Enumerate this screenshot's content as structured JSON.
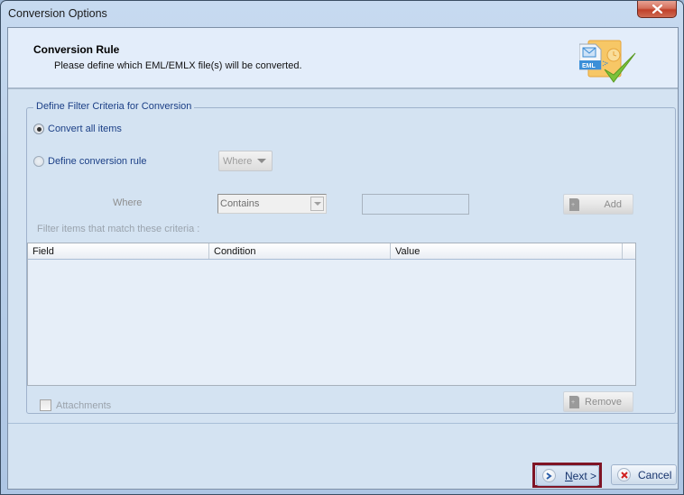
{
  "window": {
    "title": "Conversion Options",
    "close_icon": "close-x-icon"
  },
  "header": {
    "title": "Conversion Rule",
    "subtitle": "Please define which EML/EMLX file(s) will be converted.",
    "icon": "eml-convert-check-icon",
    "icon_label": "EML"
  },
  "filter_group": {
    "legend": "Define Filter Criteria for Conversion",
    "options": [
      {
        "label": "Convert all items",
        "checked": true
      },
      {
        "label": "Define conversion rule",
        "checked": false
      }
    ],
    "where_dropdown": {
      "value": "Where",
      "enabled": false
    },
    "where_label": "Where",
    "condition_combo": {
      "value": "Contains",
      "enabled": false
    },
    "value_input": {
      "value": "",
      "enabled": false
    },
    "add_button": {
      "label": "Add",
      "enabled": false
    },
    "criteria_caption": "Filter items that match these criteria :",
    "criteria_table": {
      "columns": [
        "Field",
        "Condition",
        "Value"
      ],
      "rows": []
    },
    "attachments_checkbox": {
      "label": "Attachments",
      "checked": false,
      "enabled": false
    },
    "remove_button": {
      "label": "Remove",
      "enabled": false
    }
  },
  "footer": {
    "next_button": {
      "label_mnemonic": "N",
      "label_rest": "ext >",
      "focused": true
    },
    "cancel_button": {
      "label": "Cancel"
    }
  },
  "colors": {
    "focus_highlight": "#7f1425",
    "legend_text": "#1b3f86",
    "client_bg": "#d4e3f2",
    "header_bg": "#e3edfa"
  }
}
